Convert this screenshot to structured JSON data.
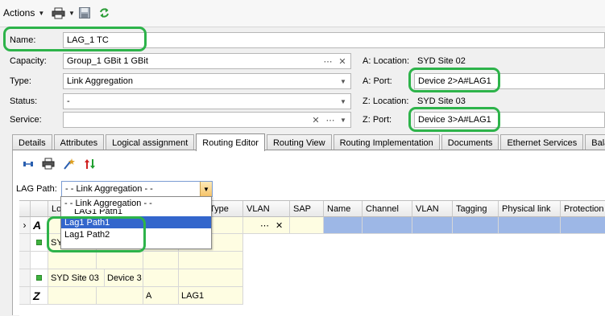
{
  "toolbar": {
    "actions_label": "Actions"
  },
  "form": {
    "name": {
      "label": "Name:",
      "value": "LAG_1 TC"
    },
    "capacity": {
      "label": "Capacity:",
      "value": "Group_1 GBit 1 GBit"
    },
    "type": {
      "label": "Type:",
      "value": "Link Aggregation"
    },
    "status": {
      "label": "Status:",
      "value": "-"
    },
    "service": {
      "label": "Service:",
      "value": ""
    },
    "a_location": {
      "label": "A: Location:",
      "value": "SYD Site 02"
    },
    "a_port": {
      "label": "A: Port:",
      "value": "Device 2>A#LAG1"
    },
    "z_location": {
      "label": "Z: Location:",
      "value": "SYD Site 03"
    },
    "z_port": {
      "label": "Z: Port:",
      "value": "Device 3>A#LAG1"
    }
  },
  "tabs": [
    "Details",
    "Attributes",
    "Logical assignment",
    "Routing Editor",
    "Routing View",
    "Routing Implementation",
    "Documents",
    "Ethernet Services",
    "Balanc"
  ],
  "active_tab": "Routing Editor",
  "lag_path": {
    "label": "LAG Path:",
    "value": "- - Link Aggregation - -",
    "options": [
      "- - Link Aggregation - -",
      "LAG1 Path1",
      "Lag1 Path1",
      "Lag1 Path2"
    ],
    "selected": "Lag1 Path1"
  },
  "grid": {
    "headers": [
      "Loc",
      "Type",
      "VLAN",
      "SAP",
      "Name",
      "Channel",
      "VLAN",
      "Tagging",
      "Physical link",
      "Protection"
    ],
    "rows": {
      "a_marker": "A",
      "a_loc": "SYD",
      "z_loc": "SYD Site 03",
      "z_device": "Device 3",
      "z_marker": "Z",
      "z_port": "A",
      "z_lag": "LAG1",
      "more": "⋯",
      "clear": "✕",
      "row_indicator": "›"
    }
  },
  "colors": {
    "highlight": "#2db34a",
    "selection": "#3366cc",
    "active_row": "#9db7e6",
    "edit_cell": "#fefde2"
  }
}
